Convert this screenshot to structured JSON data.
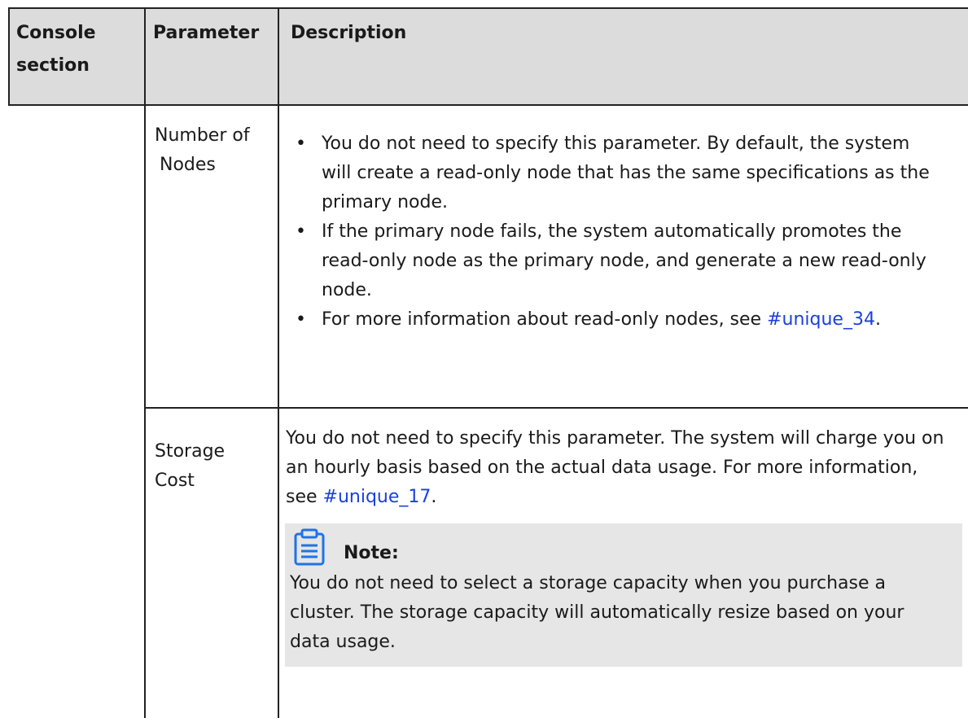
{
  "table": {
    "headers": [
      "Console section",
      "Parameter",
      "Description"
    ],
    "rows": [
      {
        "console_section": "",
        "parameter": [
          "Number of",
          "Nodes"
        ],
        "bullets": [
          "You do not need to specify this parameter. By default, the system will create a read-only node that has the same specifications as the primary node.",
          "If the primary node fails, the system automatically promotes the read-only node as the primary node, and generate a new read-only node.",
          "For more information about read-only nodes, see "
        ],
        "bullet_link": "#unique_34",
        "bullet_link_suffix": "."
      },
      {
        "console_section": "",
        "parameter": [
          "Storage",
          "Cost"
        ],
        "description": "You do not need to specify this parameter. The system will charge you on an hourly basis based on the actual data usage. For more information, see ",
        "description_link": "#unique_17",
        "description_suffix": ".",
        "note": {
          "icon": "clipboard-icon",
          "title": "Note:",
          "body": "You do not need to select a storage capacity when you purchase a cluster. The storage capacity will automatically resize based on your data usage."
        }
      }
    ]
  },
  "colors": {
    "link": "#1a3fe0",
    "header_bg": "#dcdcdc",
    "note_bg": "#e6e6e6",
    "icon": "#1e73e8"
  }
}
